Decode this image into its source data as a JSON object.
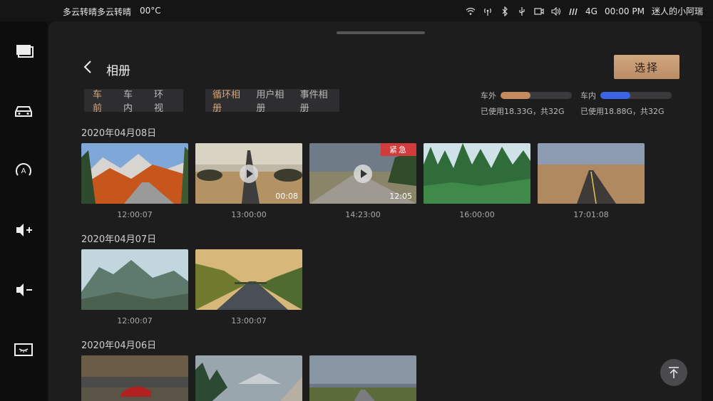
{
  "status": {
    "weather": "多云转晴多云转晴",
    "temperature": "00°C",
    "network": "4G",
    "time": "00:00 PM",
    "user": "迷人的小阿瑞"
  },
  "sidebar": {
    "items": [
      "screens-icon",
      "car-icon",
      "auto-icon",
      "volume-up-icon",
      "volume-down-icon",
      "display-off-icon"
    ]
  },
  "header": {
    "title": "相册",
    "select_label": "选择"
  },
  "camera_tabs": [
    "车前",
    "车内",
    "环视"
  ],
  "album_tabs": [
    "循环相册",
    "用户相册",
    "事件相册"
  ],
  "storage": {
    "outside": {
      "label": "车外",
      "used_text": "已使用18.33G，共32G",
      "fraction": 0.42,
      "color": "#c58a5e"
    },
    "inside": {
      "label": "车内",
      "used_text": "已使用18.88G，共32G",
      "fraction": 0.42,
      "color": "#3a63e6"
    }
  },
  "groups": [
    {
      "date": "2020年04月08日",
      "items": [
        {
          "time": "12:00:07",
          "type": "photo",
          "scene": "autumn-road"
        },
        {
          "time": "13:00:00",
          "type": "video",
          "duration": "00:08",
          "scene": "desert-road"
        },
        {
          "time": "14:23:00",
          "type": "video",
          "duration": "12:05",
          "urgent": "紧急",
          "scene": "cloudy-road"
        },
        {
          "time": "16:00:00",
          "type": "photo",
          "scene": "forest"
        },
        {
          "time": "17:01:08",
          "type": "photo",
          "scene": "plain-road"
        }
      ]
    },
    {
      "date": "2020年04月07日",
      "items": [
        {
          "time": "12:00:07",
          "type": "photo",
          "scene": "mountain"
        },
        {
          "time": "13:00:07",
          "type": "photo",
          "scene": "highway"
        }
      ]
    },
    {
      "date": "2020年04月06日",
      "items": [
        {
          "type": "photo",
          "scene": "red-car"
        },
        {
          "type": "photo",
          "scene": "mountain-forest"
        },
        {
          "type": "photo",
          "scene": "cloudy-plain"
        }
      ]
    }
  ]
}
